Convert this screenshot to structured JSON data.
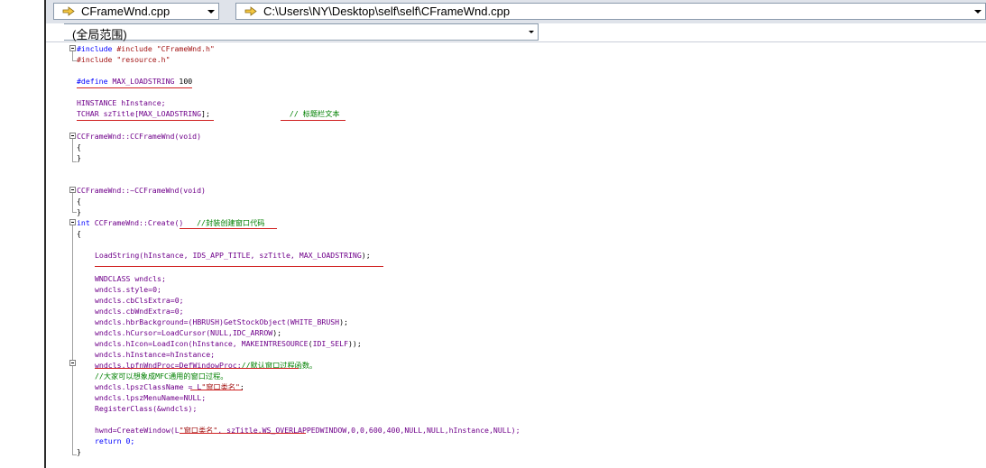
{
  "file_combo": {
    "value": "CFrameWnd.cpp"
  },
  "path_combo": {
    "value": "C:\\Users\\NY\\Desktop\\self\\self\\CFrameWnd.cpp"
  },
  "scope_combo": {
    "value": "(全局范围)"
  },
  "code": {
    "l01": "#include \"CFrameWnd.h\"",
    "l02": "#include \"resource.h\"",
    "l03_kw": "#define",
    "l03_mac": "MAX_LOADSTRING",
    "l03_val": " 100",
    "l04": "HINSTANCE hInstance;",
    "l05_a": "TCHAR szTitle[",
    "l05_mac": "MAX_LOADSTRING",
    "l05_b": "];",
    "l05_cm": "// 标题栏文本",
    "l06": "CCFrameWnd::CCFrameWnd(void)",
    "l07": "{",
    "l08": "}",
    "l09": "CCFrameWnd::~CCFrameWnd(void)",
    "l10": "{",
    "l11": "}",
    "l12_kw": "int",
    "l12_a": " CCFrameWnd::Create()   ",
    "l12_cm": "//封装创建窗口代码",
    "l13": "{",
    "l14_a": "LoadString(hInstance, ",
    "l14_mac1": "IDS_APP_TITLE",
    "l14_b": ", szTitle, ",
    "l14_mac2": "MAX_LOADSTRING",
    "l14_c": ");",
    "l15": "WNDCLASS wndcls;",
    "l16": "wndcls.style=0;",
    "l17": "wndcls.cbClsExtra=0;",
    "l18": "wndcls.cbWndExtra=0;",
    "l19_a": "wndcls.hbrBackground=(HBRUSH)GetStockObject(",
    "l19_mac": "WHITE_BRUSH",
    "l19_b": ");",
    "l20_a": "wndcls.hCursor=LoadCursor(NULL,",
    "l20_mac": "IDC_ARROW",
    "l20_b": ");",
    "l21_a": "wndcls.hIcon=LoadIcon(hInstance, ",
    "l21_mac": "MAKEINTRESOURCE",
    "l21_b": "(",
    "l21_mac2": "IDI_SELF",
    "l21_c": "));",
    "l22": "wndcls.hInstance=hInstance;",
    "l23_a": "wndcls.lpfnWndProc=DefWindowProc;",
    "l23_cm": "//默认窗口过程函数。",
    "l24_cm": "//大家可以想象成MFC通用的窗口过程。",
    "l25_a": "wndcls.lpszClassName = L",
    "l25_st": "\"窗口类名\"",
    "l25_b": ";",
    "l26": "wndcls.lpszMenuName=NULL;",
    "l27": "RegisterClass(&wndcls);",
    "l28_a": "hwnd=CreateWindow(L",
    "l28_st": "\"窗口类名\"",
    "l28_b": ", szTitle,",
    "l28_mac": "WS_OVERLAPPEDWINDOW",
    "l28_c": ",0,0,600,400,NULL,NULL,hInstance,NULL);",
    "l29": "return 0;",
    "l30": "}"
  }
}
